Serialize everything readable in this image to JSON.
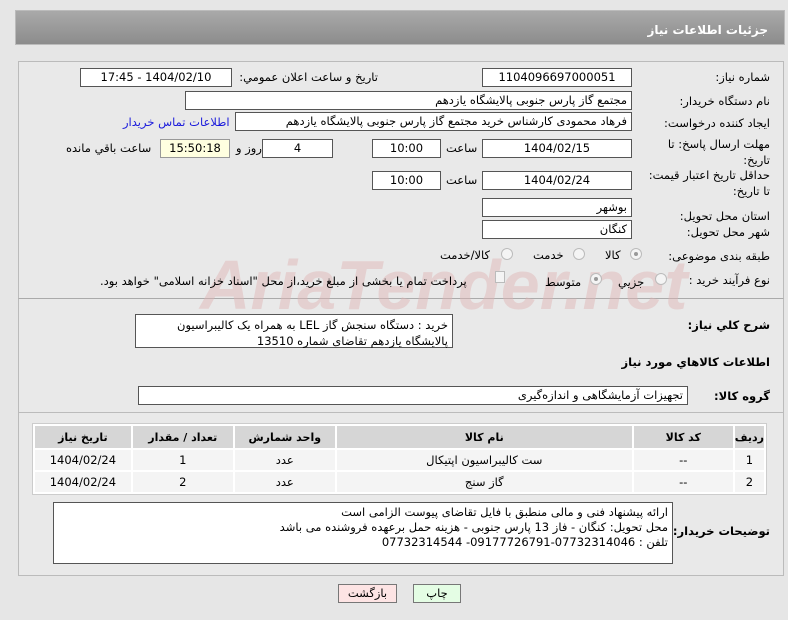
{
  "header": {
    "title": "جزئیات اطلاعات نیاز"
  },
  "watermark": "AriaTender.net",
  "fields": {
    "need_number_label": "شماره نیاز:",
    "need_number": "1104096697000051",
    "announce_label": "تاریخ و ساعت اعلان عمومي:",
    "announce_value": "1404/02/10 - 17:45",
    "buyer_org_label": "نام دستگاه خريدار:",
    "buyer_org": "مجتمع گاز پارس جنوبی  پالایشگاه یازدهم",
    "creator_label": "ایجاد کننده درخواست:",
    "creator": "فرهاد محمودی کارشناس خرید مجتمع گاز پارس جنوبی  پالایشگاه یازدهم",
    "contact_link": "اطلاعات تماس خریدار",
    "deadline_label": "مهلت ارسال پاسخ: تا تاریخ:",
    "deadline_date": "1404/02/15",
    "time_label": "ساعت",
    "deadline_time": "10:00",
    "days": "4",
    "days_label": "روز و",
    "remaining": "15:50:18",
    "remaining_label": "ساعت باقي مانده",
    "validity_label": "حداقل تاریخ اعتبار قیمت: تا تاریخ:",
    "validity_date": "1404/02/24",
    "validity_time": "10:00",
    "province_label": "استان محل تحویل:",
    "province": "بوشهر",
    "city_label": "شهر محل تحویل:",
    "city": "کنگان",
    "category_label": "طبقه بندی موضوعی:",
    "category_options": [
      "کالا",
      "خدمت",
      "کالا/خدمت"
    ],
    "process_label": "نوع فرآيند خريد :",
    "process_options": [
      "جزيي",
      "متوسط"
    ],
    "payment_note": "پرداخت تمام یا بخشی از مبلغ خرید،از محل \"اسناد خزانه اسلامی\" خواهد بود."
  },
  "description": {
    "label": "شرح کلي نياز:",
    "text": "خرید : دستگاه سنجش گاز LEL به همراه یک کالیبراسیون پالایشگاه یازدهم تقاضای شماره 13510"
  },
  "goods": {
    "heading": "اطلاعات کالاهاي مورد نياز",
    "group_label": "گروه کالا:",
    "group": "تجهیزات آزمایشگاهی و اندازه‌گیری",
    "columns": [
      "رديف",
      "کد کالا",
      "نام کالا",
      "واحد شمارش",
      "تعداد / مقدار",
      "تاريخ نياز"
    ],
    "rows": [
      [
        "1",
        "--",
        "ست کالیبراسیون اپتیکال",
        "عدد",
        "1",
        "1404/02/24"
      ],
      [
        "2",
        "--",
        "گاز سنج",
        "عدد",
        "2",
        "1404/02/24"
      ]
    ]
  },
  "notes": {
    "label": "توضيحات خريدار:",
    "text": "ارائه پیشنهاد فنی و مالی منطبق با فایل تقاضای پیوست الزامی است\nمحل تحویل: کنگان - فاز 13 پارس جنوبی - هزینه حمل برعهده فروشنده می باشد\nتلفن : 07732314046-09177726791- 07732314544"
  },
  "buttons": {
    "print": "چاپ",
    "back": "بازگشت"
  }
}
